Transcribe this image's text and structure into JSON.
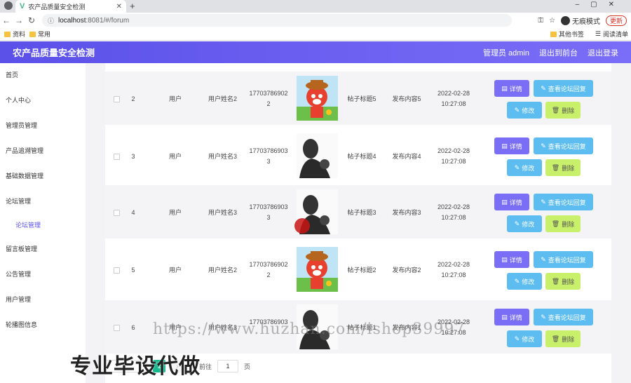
{
  "browser": {
    "tab_title": "农产品质量安全检测",
    "url_host": "localhost",
    "url_path": ":8081/#/forum",
    "incognito_label": "无痕模式",
    "update_label": "更新",
    "bookmarks": [
      "资料",
      "常用"
    ],
    "bookmarks_right": [
      "其他书签",
      "阅读清单"
    ]
  },
  "header": {
    "title": "农产品质量安全检测",
    "user": "管理员 admin",
    "back_front": "退出到前台",
    "logout": "退出登录"
  },
  "sidebar": {
    "items": [
      "首页",
      "个人中心",
      "管理员管理",
      "产品追溯管理",
      "基础数据管理",
      "论坛管理",
      "论坛管理",
      "留言板管理",
      "公告管理",
      "用户管理",
      "轮播图信息"
    ]
  },
  "table": {
    "rows": [
      {
        "idx": "2",
        "role": "用户",
        "name": "用户姓名2",
        "phone1": "17703786902",
        "phone2": "2",
        "avatar": "fox",
        "title": "帖子标题5",
        "content": "发布内容5",
        "date": "2022-02-28",
        "time": "10:27:08"
      },
      {
        "idx": "3",
        "role": "用户",
        "name": "用户姓名3",
        "phone1": "17703786903",
        "phone2": "3",
        "avatar": "silhouette",
        "title": "帖子标题4",
        "content": "发布内容4",
        "date": "2022-02-28",
        "time": "10:27:08"
      },
      {
        "idx": "4",
        "role": "用户",
        "name": "用户姓名3",
        "phone1": "17703786903",
        "phone2": "3",
        "avatar": "silhouette",
        "title": "帖子标题3",
        "content": "发布内容3",
        "date": "2022-02-28",
        "time": "10:27:08"
      },
      {
        "idx": "5",
        "role": "用户",
        "name": "用户姓名2",
        "phone1": "17703786902",
        "phone2": "2",
        "avatar": "fox",
        "title": "帖子标题2",
        "content": "发布内容2",
        "date": "2022-02-28",
        "time": "10:27:08"
      },
      {
        "idx": "6",
        "role": "用户",
        "name": "用户姓名3",
        "phone1": "17703786903",
        "phone2": "",
        "avatar": "silhouette",
        "title": "帖子标题1",
        "content": "发布内容1",
        "date": "2022-02-28",
        "time": "10:27:08"
      }
    ],
    "buttons": {
      "detail": "详情",
      "reply": "查看论坛回复",
      "edit": "修改",
      "delete": "删除"
    }
  },
  "pager": {
    "current": "1",
    "goto_label": "前往",
    "goto_value": "1",
    "page_suffix": "页"
  },
  "watermark": "https://www.huzhan.com/ishop39997",
  "overlay": "专业毕设代做",
  "colors": {
    "header": "#5b50e8",
    "detail_btn": "#7b6ef6",
    "reply_btn": "#5dbdf0",
    "delete_btn": "#c8f06a",
    "pager_active": "#17b890"
  }
}
